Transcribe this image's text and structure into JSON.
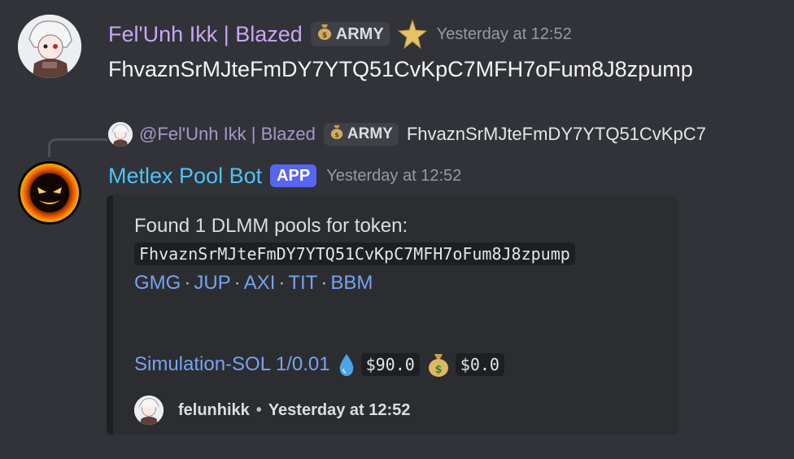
{
  "message1": {
    "author": "Fel'Unh Ikk | Blazed",
    "role_tag": "ARMY",
    "role_tag_icon": "moneybag-icon",
    "badge_icon": "gold-star-icon",
    "timestamp": "Yesterday at 12:52",
    "content": "FhvaznSrMJteFmDY7YTQ51CvKpC7MFH7oFum8J8zpump"
  },
  "reply": {
    "mention": "@Fel'Unh Ikk | Blazed",
    "role_tag": "ARMY",
    "snippet": "FhvaznSrMJteFmDY7YTQ51CvKpC7"
  },
  "message2": {
    "author": "Metlex Pool Bot",
    "badge": "APP",
    "timestamp": "Yesterday at 12:52",
    "embed": {
      "line1": "Found 1 DLMM pools for token:",
      "token": "FhvaznSrMJteFmDY7YTQ51CvKpC7MFH7oFum8J8zpump",
      "links": [
        "GMG",
        "JUP",
        "AXI",
        "TIT",
        "BBM"
      ],
      "simulation_label": "Simulation-SOL 1/0.01",
      "liquidity": "$90.0",
      "fees": "$0.0",
      "footer_user": "felunhikk",
      "footer_sep": "•",
      "footer_time": "Yesterday at 12:52"
    }
  },
  "colors": {
    "background": "#313338",
    "user_name": "#c9a6f5",
    "bot_name": "#4fc3f7",
    "app_badge": "#5865f2",
    "link": "#77a3f1"
  }
}
